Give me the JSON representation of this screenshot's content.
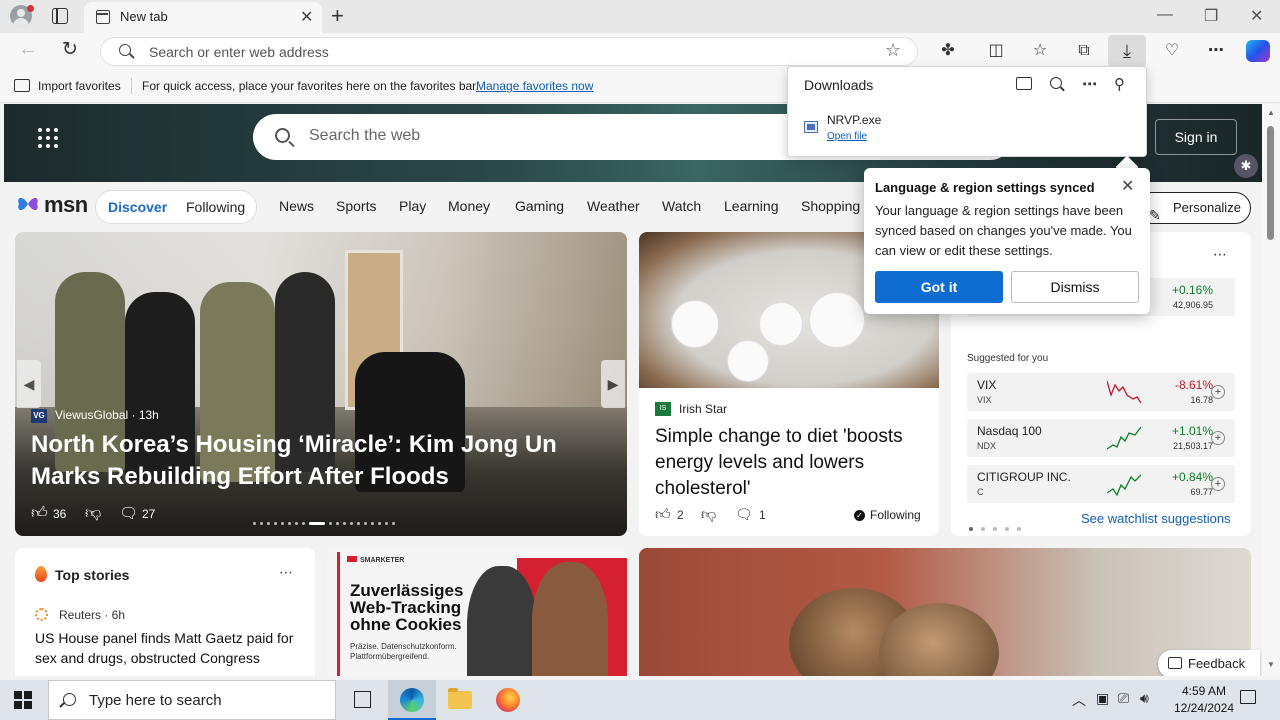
{
  "browser": {
    "tab_title": "New tab",
    "address_placeholder": "Search or enter web address",
    "favorites_bar": {
      "import_label": "Import favorites",
      "message": "For quick access, place your favorites here on the favorites bar.",
      "manage_link": "Manage favorites now"
    }
  },
  "downloads_panel": {
    "title": "Downloads",
    "items": [
      {
        "filename": "NRVP.exe",
        "action": "Open file"
      }
    ]
  },
  "sync_popup": {
    "title": "Language & region settings synced",
    "body": "Your language & region settings have been synced based on changes you've made. You can view or edit these settings.",
    "primary_button": "Got it",
    "secondary_button": "Dismiss"
  },
  "msn": {
    "search_placeholder": "Search the web",
    "sign_in": "Sign in",
    "logo_text": "msn",
    "pill_tabs": [
      "Discover",
      "Following"
    ],
    "nav_items": [
      "News",
      "Sports",
      "Play",
      "Money",
      "Gaming",
      "Weather",
      "Watch",
      "Learning",
      "Shopping"
    ],
    "personalize": "Personalize",
    "main_story": {
      "source_badge": "VG",
      "source": "ViewusGlobal · 13h",
      "title": "North Korea’s Housing ‘Miracle’: Kim Jong Un Marks Rebuilding Effort After Floods",
      "likes": "36",
      "comments": "27"
    },
    "diet_story": {
      "source_badge": "IS",
      "source": "Irish Star",
      "title": "Simple change to diet 'boosts energy levels and lowers cholesterol'",
      "likes": "2",
      "comments": "1",
      "following": "Following"
    },
    "watchlist": {
      "top_row": {
        "change": "+0.16%",
        "price": "42,906.95"
      },
      "suggested_label": "Suggested for you",
      "items": [
        {
          "name": "VIX",
          "symbol": "VIX",
          "change": "-8.61%",
          "price": "16.78",
          "direction": "down"
        },
        {
          "name": "Nasdaq 100",
          "symbol": "NDX",
          "change": "+1.01%",
          "price": "21,503.17",
          "direction": "up"
        },
        {
          "name": "CITIGROUP INC.",
          "symbol": "C",
          "change": "+0.84%",
          "price": "69.77",
          "direction": "up"
        }
      ],
      "see_more": "See watchlist suggestions",
      "colors": {
        "up": "#0c7d2a",
        "down": "#c5162a"
      }
    },
    "top_stories": {
      "title": "Top stories",
      "source": "Reuters · 6h",
      "headline": "US House panel finds Matt Gaetz paid for sex and drugs, obstructed Congress"
    },
    "ad": {
      "brand": "SMARKETER",
      "headline": "Zuverlässiges Web-Tracking ohne Cookies",
      "subtext": "Präzise. Datenschutzkonform. Plattformübergreifend."
    },
    "feedback": "Feedback"
  },
  "taskbar": {
    "search_placeholder": "Type here to search",
    "time": "4:59 AM",
    "date": "12/24/2024"
  }
}
